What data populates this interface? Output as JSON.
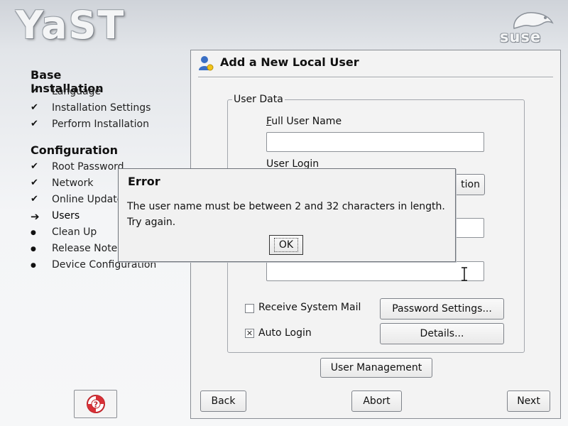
{
  "branding": {
    "yast_logo": "YaST",
    "suse_logo": "suse"
  },
  "sidebar": {
    "sections": [
      {
        "title": "Base Installation",
        "steps": [
          {
            "label": "Language",
            "status": "done"
          },
          {
            "label": "Installation Settings",
            "status": "done"
          },
          {
            "label": "Perform Installation",
            "status": "done"
          }
        ]
      },
      {
        "title": "Configuration",
        "steps": [
          {
            "label": "Root Password",
            "status": "done"
          },
          {
            "label": "Network",
            "status": "done"
          },
          {
            "label": "Online Update",
            "status": "done"
          },
          {
            "label": "Users",
            "status": "current"
          },
          {
            "label": "Clean Up",
            "status": "pending"
          },
          {
            "label": "Release Notes",
            "status": "pending"
          },
          {
            "label": "Device Configuration",
            "status": "pending"
          }
        ]
      }
    ],
    "status_marks": {
      "done": "✔",
      "current": "➔",
      "pending": "●"
    },
    "help_icon": "lifebuoy-icon"
  },
  "dialog_panel": {
    "title": "Add a New Local User",
    "group_title": "User Data",
    "full_name_label": "Full User Name",
    "full_name_value": "",
    "user_login_label": "User Login",
    "user_login_value": "",
    "hidden_button_visible_text": "tion",
    "password_value": "",
    "verify_value": "",
    "receive_mail": {
      "label": "Receive System Mail",
      "checked": false
    },
    "auto_login": {
      "label": "Auto Login",
      "checked": true
    },
    "password_settings_button": "Password Settings...",
    "details_button": "Details...",
    "user_management_button": "User Management",
    "back_button": "Back",
    "abort_button": "Abort",
    "next_button": "Next"
  },
  "error_dialog": {
    "title": "Error",
    "message_line1": "The user name must be between 2 and 32 characters in length.",
    "message_line2": "Try again.",
    "ok_button": "OK"
  },
  "colors": {
    "panel_bg": "#f3f3f3",
    "background_top": "#cfd3d9",
    "icon_blue": "#3a6fc4"
  }
}
